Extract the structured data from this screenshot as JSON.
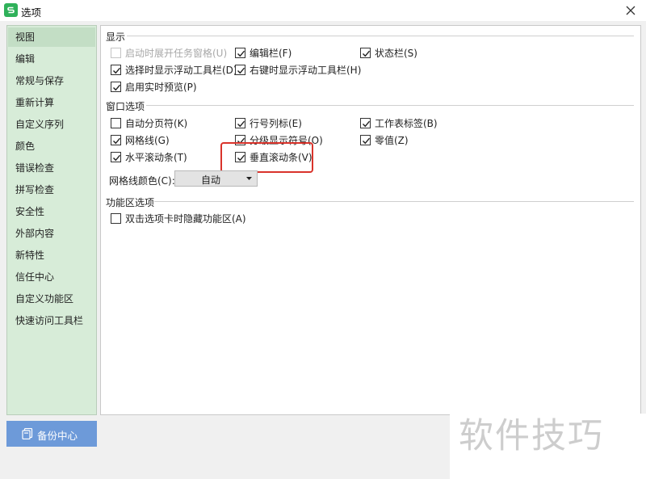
{
  "window": {
    "title": "选项"
  },
  "sidebar": {
    "items": [
      {
        "label": "视图",
        "selected": true
      },
      {
        "label": "编辑"
      },
      {
        "label": "常规与保存"
      },
      {
        "label": "重新计算"
      },
      {
        "label": "自定义序列"
      },
      {
        "label": "颜色"
      },
      {
        "label": "错误检查"
      },
      {
        "label": "拼写检查"
      },
      {
        "label": "安全性"
      },
      {
        "label": "外部内容"
      },
      {
        "label": "新特性"
      },
      {
        "label": "信任中心"
      },
      {
        "label": "自定义功能区"
      },
      {
        "label": "快速访问工具栏"
      }
    ],
    "backup_button": "备份中心"
  },
  "display": {
    "title": "显示",
    "options": [
      {
        "label": "启动时展开任务窗格(U)",
        "checked": false,
        "disabled": true
      },
      {
        "label": "编辑栏(F)",
        "checked": true
      },
      {
        "label": "状态栏(S)",
        "checked": true
      },
      {
        "label": "选择时显示浮动工具栏(D)",
        "checked": true
      },
      {
        "label": "右键时显示浮动工具栏(H)",
        "checked": true
      },
      {
        "label": "启用实时预览(P)",
        "checked": true
      }
    ]
  },
  "window_options": {
    "title": "窗口选项",
    "options": [
      {
        "label": "自动分页符(K)",
        "checked": false
      },
      {
        "label": "行号列标(E)",
        "checked": true
      },
      {
        "label": "工作表标签(B)",
        "checked": true
      },
      {
        "label": "网格线(G)",
        "checked": true
      },
      {
        "label": "分级显示符号(O)",
        "checked": true
      },
      {
        "label": "零值(Z)",
        "checked": true
      },
      {
        "label": "水平滚动条(T)",
        "checked": true
      },
      {
        "label": "垂直滚动条(V)",
        "checked": true
      }
    ],
    "grid_color_label": "网格线颜色(C):",
    "grid_color_value": "自动"
  },
  "ribbon": {
    "title": "功能区选项",
    "options": [
      {
        "label": "双击选项卡时隐藏功能区(A)",
        "checked": false
      }
    ]
  },
  "colors": {
    "sidebar_bg": "#d7ecd8",
    "backup_bg": "#6d9ad9",
    "highlight": "#d9332b",
    "app_icon": "#2fb15a"
  },
  "watermark": "软件技巧"
}
